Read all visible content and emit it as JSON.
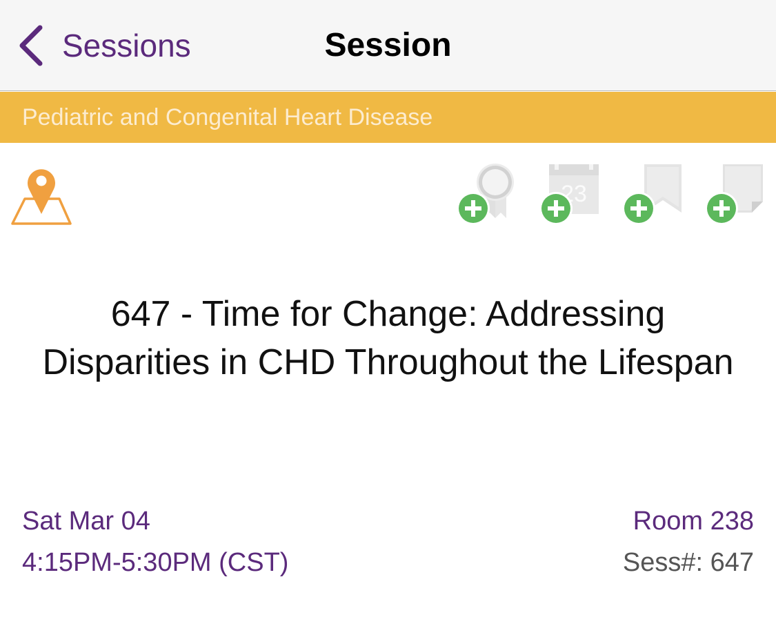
{
  "nav": {
    "back_label": "Sessions",
    "title": "Session"
  },
  "category": "Pediatric and Congenital Heart Disease",
  "icons": {
    "location": "map-pin-icon",
    "actions": [
      "award-add-icon",
      "calendar-add-icon",
      "bookmark-add-icon",
      "note-add-icon"
    ]
  },
  "calendar_day": "23",
  "session": {
    "title": "647 - Time for Change: Addressing Disparities in CHD Throughout the Lifespan",
    "date": "Sat Mar 04",
    "time": "4:15PM-5:30PM (CST)",
    "room": "Room 238",
    "sess_num": "Sess#: 647"
  },
  "colors": {
    "accent": "#5b2a7c",
    "category_bar": "#f0b944",
    "add_badge": "#5cb85c",
    "map_pin": "#f0a040"
  }
}
